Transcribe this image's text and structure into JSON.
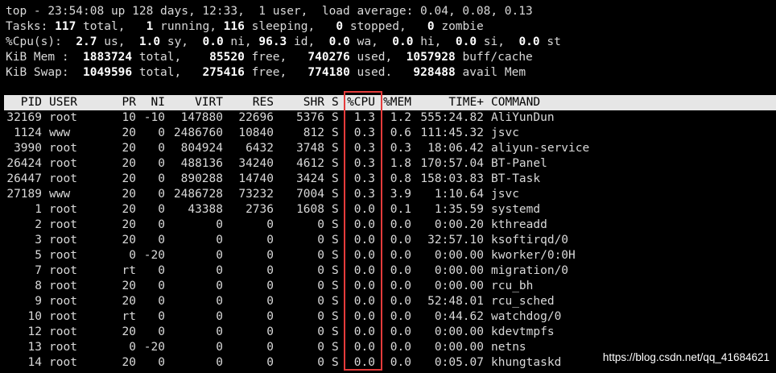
{
  "summary": {
    "line1": {
      "text": "top - 23:54:08 up 128 days, 12:33,  1 user,  load average: 0.04, 0.08, 0.13"
    },
    "line2": {
      "p0": "Tasks: ",
      "total": "117",
      "p1": " total,   ",
      "running": "1",
      "p2": " running, ",
      "sleeping": "116",
      "p3": " sleeping,   ",
      "stopped": "0",
      "p4": " stopped,   ",
      "zombie": "0",
      "p5": " zombie"
    },
    "line3": {
      "p0": "%Cpu(s):  ",
      "us": "2.7",
      "p1": " us,  ",
      "sy": "1.0",
      "p2": " sy,  ",
      "ni": "0.0",
      "p3": " ni, ",
      "id": "96.3",
      "p4": " id,  ",
      "wa": "0.0",
      "p5": " wa,  ",
      "hi": "0.0",
      "p6": " hi,  ",
      "si": "0.0",
      "p7": " si,  ",
      "st": "0.0",
      "p8": " st"
    },
    "line4": {
      "p0": "KiB Mem :  ",
      "total": "1883724",
      "p1": " total,    ",
      "free": "85520",
      "p2": " free,   ",
      "used": "740276",
      "p3": " used,  ",
      "cache": "1057928",
      "p4": " buff/cache"
    },
    "line5": {
      "p0": "KiB Swap:  ",
      "total": "1049596",
      "p1": " total,   ",
      "free": "275416",
      "p2": " free,   ",
      "used": "774180",
      "p3": " used.   ",
      "avail": "928488",
      "p4": " avail Mem"
    }
  },
  "columns": [
    "PID",
    "USER",
    "PR",
    "NI",
    "VIRT",
    "RES",
    "SHR",
    "S",
    "%CPU",
    "%MEM",
    "TIME+",
    "COMMAND"
  ],
  "processes": [
    [
      "32169",
      "root",
      "10",
      "-10",
      "147880",
      "22696",
      "5376",
      "S",
      "1.3",
      "1.2",
      "555:24.82",
      "AliYunDun"
    ],
    [
      "1124",
      "www",
      "20",
      "0",
      "2486760",
      "10840",
      "812",
      "S",
      "0.3",
      "0.6",
      "111:45.32",
      "jsvc"
    ],
    [
      "3990",
      "root",
      "20",
      "0",
      "804924",
      "6432",
      "3748",
      "S",
      "0.3",
      "0.3",
      "18:06.42",
      "aliyun-service"
    ],
    [
      "26424",
      "root",
      "20",
      "0",
      "488136",
      "34240",
      "4612",
      "S",
      "0.3",
      "1.8",
      "170:57.04",
      "BT-Panel"
    ],
    [
      "26447",
      "root",
      "20",
      "0",
      "890288",
      "14740",
      "3424",
      "S",
      "0.3",
      "0.8",
      "158:03.83",
      "BT-Task"
    ],
    [
      "27189",
      "www",
      "20",
      "0",
      "2486728",
      "73232",
      "7004",
      "S",
      "0.3",
      "3.9",
      "1:10.64",
      "jsvc"
    ],
    [
      "1",
      "root",
      "20",
      "0",
      "43388",
      "2736",
      "1608",
      "S",
      "0.0",
      "0.1",
      "1:35.59",
      "systemd"
    ],
    [
      "2",
      "root",
      "20",
      "0",
      "0",
      "0",
      "0",
      "S",
      "0.0",
      "0.0",
      "0:00.20",
      "kthreadd"
    ],
    [
      "3",
      "root",
      "20",
      "0",
      "0",
      "0",
      "0",
      "S",
      "0.0",
      "0.0",
      "32:57.10",
      "ksoftirqd/0"
    ],
    [
      "5",
      "root",
      "0",
      "-20",
      "0",
      "0",
      "0",
      "S",
      "0.0",
      "0.0",
      "0:00.00",
      "kworker/0:0H"
    ],
    [
      "7",
      "root",
      "rt",
      "0",
      "0",
      "0",
      "0",
      "S",
      "0.0",
      "0.0",
      "0:00.00",
      "migration/0"
    ],
    [
      "8",
      "root",
      "20",
      "0",
      "0",
      "0",
      "0",
      "S",
      "0.0",
      "0.0",
      "0:00.00",
      "rcu_bh"
    ],
    [
      "9",
      "root",
      "20",
      "0",
      "0",
      "0",
      "0",
      "S",
      "0.0",
      "0.0",
      "52:48.01",
      "rcu_sched"
    ],
    [
      "10",
      "root",
      "rt",
      "0",
      "0",
      "0",
      "0",
      "S",
      "0.0",
      "0.0",
      "0:44.62",
      "watchdog/0"
    ],
    [
      "12",
      "root",
      "20",
      "0",
      "0",
      "0",
      "0",
      "S",
      "0.0",
      "0.0",
      "0:00.00",
      "kdevtmpfs"
    ],
    [
      "13",
      "root",
      "0",
      "-20",
      "0",
      "0",
      "0",
      "S",
      "0.0",
      "0.0",
      "0:00.00",
      "netns"
    ],
    [
      "14",
      "root",
      "20",
      "0",
      "0",
      "0",
      "0",
      "S",
      "0.0",
      "0.0",
      "0:05.07",
      "khungtaskd"
    ]
  ],
  "watermark": "https://blog.csdn.net/qq_41684621",
  "colors": {
    "background": "#000000",
    "text": "#d9d9d9",
    "header_bar": "#e6e6e6",
    "highlight": "#e53b3b"
  }
}
